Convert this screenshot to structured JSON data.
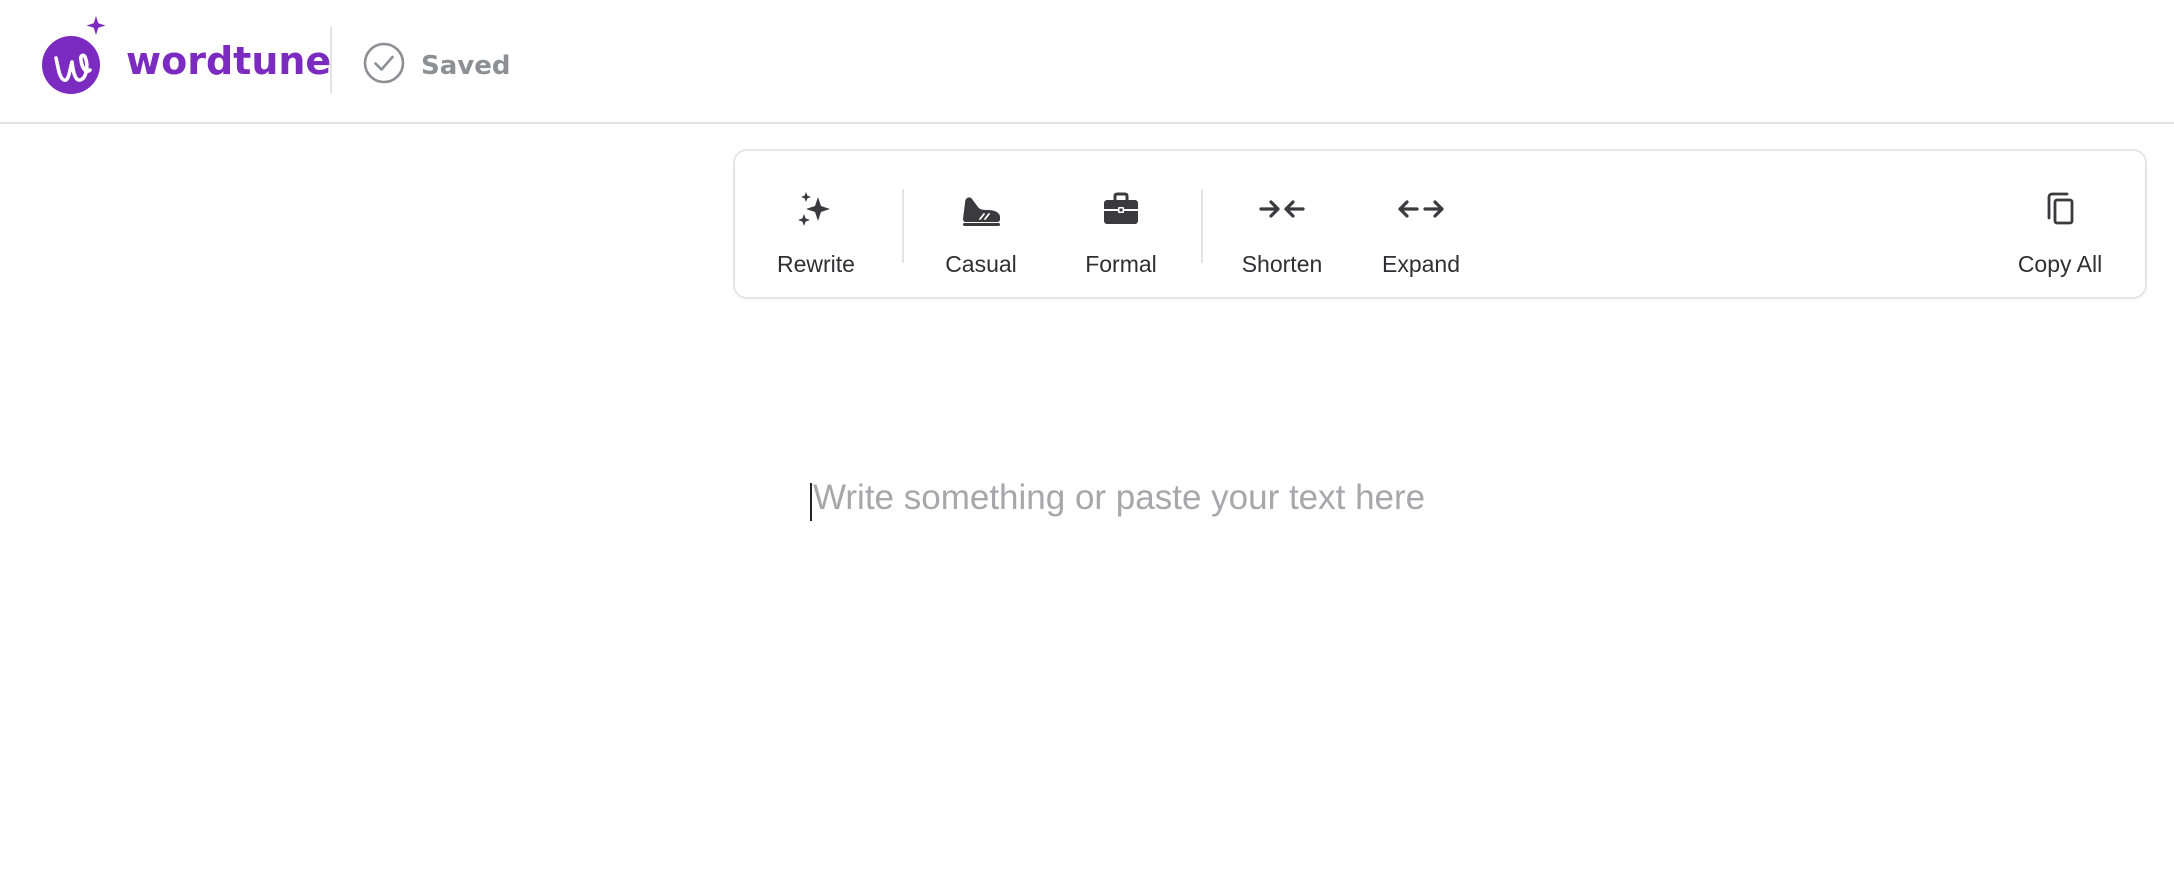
{
  "brand": {
    "name": "wordtune",
    "color": "#7b2bbf"
  },
  "status": {
    "saved_label": "Saved",
    "icon": "check-circle-icon"
  },
  "toolbar": {
    "rewrite": {
      "label": "Rewrite",
      "icon": "sparkles-icon"
    },
    "casual": {
      "label": "Casual",
      "icon": "sneaker-icon"
    },
    "formal": {
      "label": "Formal",
      "icon": "briefcase-icon"
    },
    "shorten": {
      "label": "Shorten",
      "icon": "arrows-in-icon"
    },
    "expand": {
      "label": "Expand",
      "icon": "arrows-out-icon"
    },
    "copy_all": {
      "label": "Copy All",
      "icon": "copy-icon"
    }
  },
  "editor": {
    "placeholder": "Write something or paste your text here",
    "value": ""
  }
}
